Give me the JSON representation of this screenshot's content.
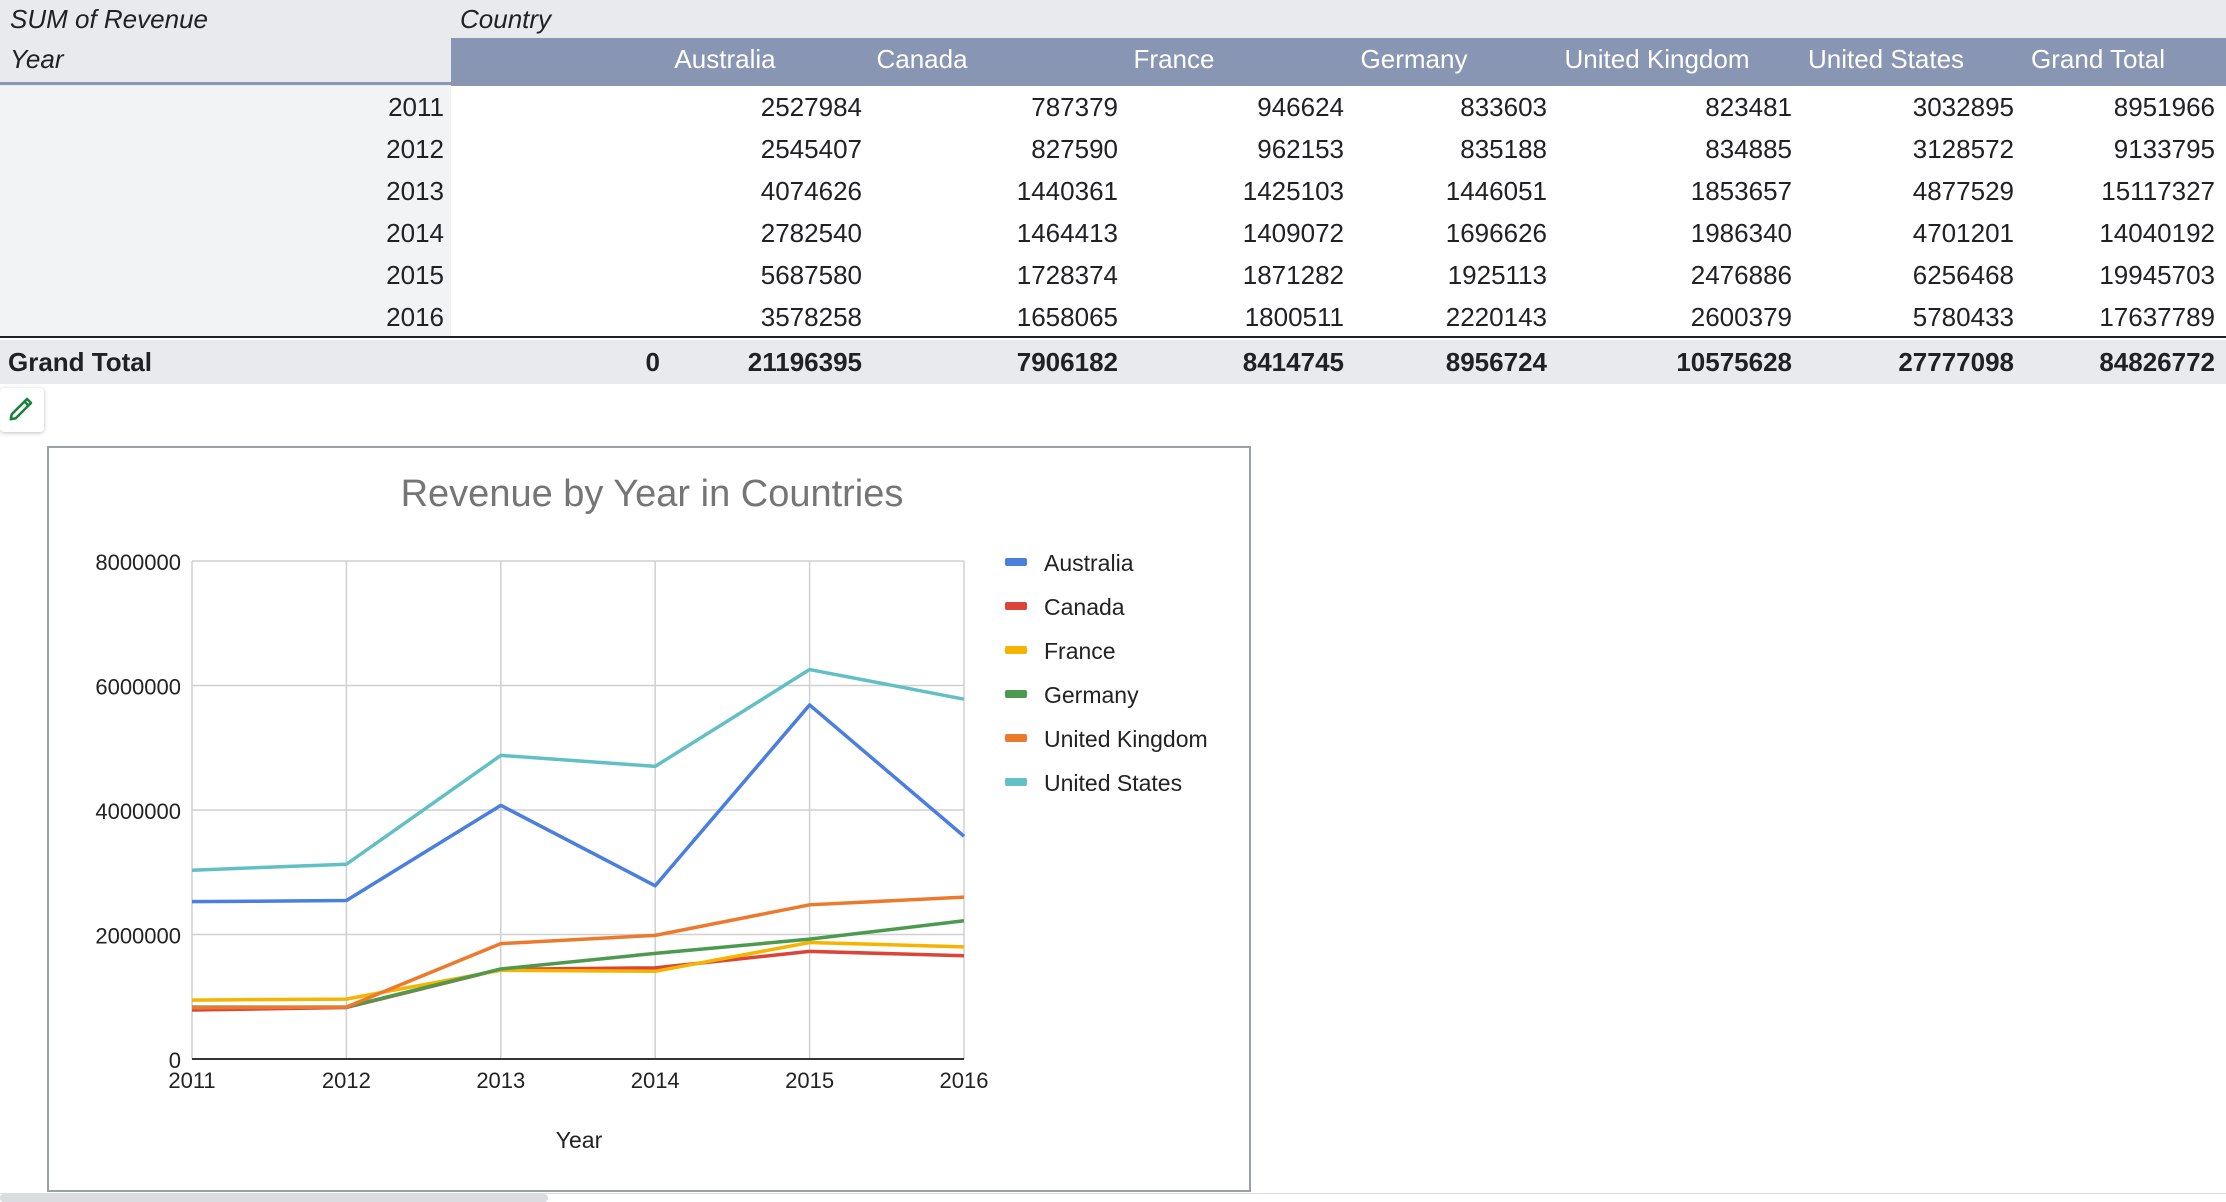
{
  "pivot": {
    "values_label": "SUM of Revenue",
    "columns_label": "Country",
    "rows_label": "Year",
    "columns": [
      "Australia",
      "Canada",
      "France",
      "Germany",
      "United Kingdom",
      "United States",
      "Grand Total"
    ],
    "rows": [
      {
        "year": "2011",
        "values": [
          "2527984",
          "787379",
          "946624",
          "833603",
          "823481",
          "3032895",
          "8951966"
        ]
      },
      {
        "year": "2012",
        "values": [
          "2545407",
          "827590",
          "962153",
          "835188",
          "834885",
          "3128572",
          "9133795"
        ]
      },
      {
        "year": "2013",
        "values": [
          "4074626",
          "1440361",
          "1425103",
          "1446051",
          "1853657",
          "4877529",
          "15117327"
        ]
      },
      {
        "year": "2014",
        "values": [
          "2782540",
          "1464413",
          "1409072",
          "1696626",
          "1986340",
          "4701201",
          "14040192"
        ]
      },
      {
        "year": "2015",
        "values": [
          "5687580",
          "1728374",
          "1871282",
          "1925113",
          "2476886",
          "6256468",
          "19945703"
        ]
      },
      {
        "year": "2016",
        "values": [
          "3578258",
          "1658065",
          "1800511",
          "2220143",
          "2600379",
          "5780433",
          "17637789"
        ]
      }
    ],
    "grand_total": {
      "label": "Grand Total",
      "blank_value": "0",
      "values": [
        "21196395",
        "7906182",
        "8414745",
        "8956724",
        "10575628",
        "27777098",
        "84826772"
      ]
    }
  },
  "edit_icon": "pencil-icon",
  "chart_data": {
    "type": "line",
    "title": "Revenue by Year in Countries",
    "xlabel": "Year",
    "ylabel": "",
    "x": [
      "2011",
      "2012",
      "2013",
      "2014",
      "2015",
      "2016"
    ],
    "ylim": [
      0,
      8000000
    ],
    "yticks": [
      "0",
      "2000000",
      "4000000",
      "6000000",
      "8000000"
    ],
    "grid": true,
    "legend_position": "right",
    "series": [
      {
        "name": "Australia",
        "color": "#4a7fe0",
        "values": [
          2527984,
          2545407,
          4074626,
          2782540,
          5687580,
          3578258
        ]
      },
      {
        "name": "Canada",
        "color": "#db4437",
        "values": [
          787379,
          827590,
          1440361,
          1464413,
          1728374,
          1658065
        ]
      },
      {
        "name": "France",
        "color": "#f4b400",
        "values": [
          946624,
          962153,
          1425103,
          1409072,
          1871282,
          1800511
        ]
      },
      {
        "name": "Germany",
        "color": "#4c9a4f",
        "values": [
          833603,
          835188,
          1446051,
          1696626,
          1925113,
          2220143
        ]
      },
      {
        "name": "United Kingdom",
        "color": "#ec7a2d",
        "values": [
          823481,
          834885,
          1853657,
          1986340,
          2476886,
          2600379
        ]
      },
      {
        "name": "United States",
        "color": "#62bfc4",
        "values": [
          3032895,
          3128572,
          4877529,
          4701201,
          6256468,
          5780433
        ]
      }
    ]
  }
}
